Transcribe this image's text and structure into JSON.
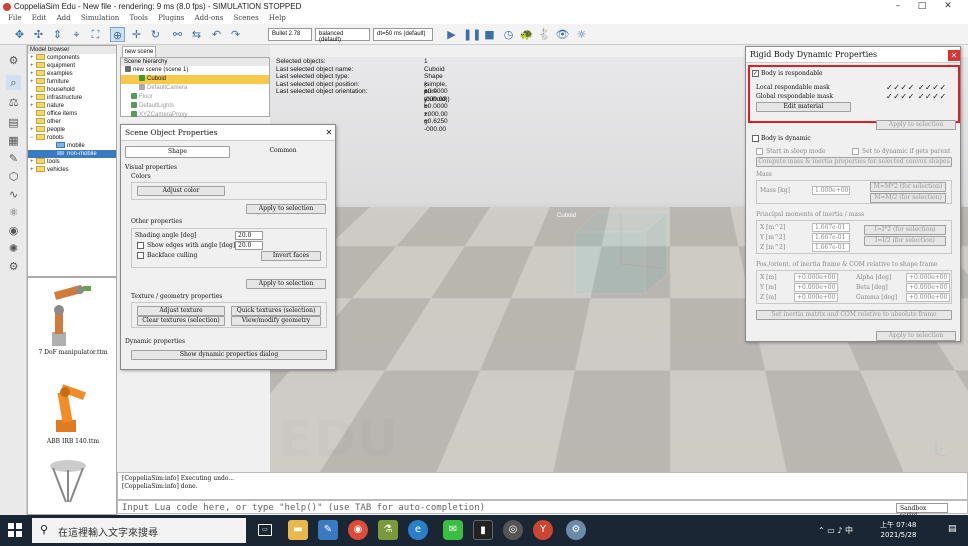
{
  "window": {
    "title": "CoppeliaSim Edu - New file - rendering: 9 ms (8.0 fps) - SIMULATION STOPPED"
  },
  "menu": [
    "File",
    "Edit",
    "Add",
    "Simulation",
    "Tools",
    "Plugins",
    "Add-ons",
    "Scenes",
    "Help"
  ],
  "toolbar": {
    "engine": "Bullet 2.78",
    "accuracy": "balanced (default)",
    "timestep": "dt=50 ms (default)"
  },
  "model_browser": {
    "header": "Model browser",
    "items": [
      {
        "label": "components",
        "expand": "+"
      },
      {
        "label": "equipment",
        "expand": "+"
      },
      {
        "label": "examples",
        "expand": "+"
      },
      {
        "label": "furniture",
        "expand": "+"
      },
      {
        "label": "household",
        "expand": ""
      },
      {
        "label": "infrastructure",
        "expand": "+"
      },
      {
        "label": "nature",
        "expand": "+"
      },
      {
        "label": "office items",
        "expand": ""
      },
      {
        "label": "other",
        "expand": ""
      },
      {
        "label": "people",
        "expand": "+"
      },
      {
        "label": "robots",
        "expand": "−"
      },
      {
        "label": "mobile",
        "expand": ""
      },
      {
        "label": "non-mobile",
        "expand": ""
      },
      {
        "label": "tools",
        "expand": "+"
      },
      {
        "label": "vehicles",
        "expand": "+"
      }
    ],
    "thumbnails": [
      "7 DoF manipulator.ttm",
      "ABB IRB 140.ttm"
    ]
  },
  "scene": {
    "tab": "new scene",
    "hierarchy_header": "Scene hierarchy",
    "items": [
      {
        "label": "new scene (scene 1)",
        "indent": 0
      },
      {
        "label": "Cuboid",
        "indent": 1
      },
      {
        "label": "DefaultCamera",
        "indent": 1
      },
      {
        "label": "Floor",
        "indent": 1
      },
      {
        "label": "DefaultLights",
        "indent": 1
      },
      {
        "label": "XYZCameraProxy",
        "indent": 1
      }
    ]
  },
  "viewport_info": {
    "rows": [
      {
        "label": "Selected objects:",
        "value": "1"
      },
      {
        "label": "Last selected object name:",
        "value": "Cuboid"
      },
      {
        "label": "Last selected object type:",
        "value": "Shape (simple, pure (cuboid))"
      },
      {
        "label": "Last selected object position:",
        "value": "x: +0.0000    y: +0.0000    z: +0.6250"
      },
      {
        "label": "Last selected object orientation:",
        "value": "a: -000.00    b: +000.00    g: -000.00"
      }
    ],
    "cube_label": "Cuboid",
    "watermark": "EDU"
  },
  "scene_object_props": {
    "title": "Scene Object Properties",
    "tabs": [
      "Shape",
      "Common"
    ],
    "visual_header": "Visual properties",
    "colors_label": "Colors",
    "adjust_color": "Adjust color",
    "apply_selection": "Apply to selection",
    "other_header": "Other properties",
    "shading_label": "Shading angle [deg]",
    "shading_value": "20.0",
    "edges_label": "Show edges with angle [deg]",
    "edges_value": "20.0",
    "backface_label": "Backface culling",
    "invert_faces": "Invert faces",
    "texture_header": "Texture / geometry properties",
    "adjust_texture": "Adjust texture",
    "quick_textures": "Quick textures (selection)",
    "clear_textures": "Clear textures (selection)",
    "view_geometry": "View/modify geometry",
    "dynamic_header": "Dynamic properties",
    "show_dynamic": "Show dynamic properties dialog"
  },
  "rigid_body": {
    "title": "Rigid Body Dynamic Properties",
    "respondable_label": "Body is respondable",
    "local_mask_label": "Local respondable mask",
    "global_mask_label": "Global respondable mask",
    "mask_checks": "✓✓✓✓  ✓✓✓✓",
    "edit_material": "Edit material",
    "apply_selection": "Apply to selection",
    "dynamic_label": "Body is dynamic",
    "sleep_label": "Start in sleep mode",
    "set_dynamic_label": "Set to dynamic if gets parent",
    "compute_mass": "Compute mass & inertia properties for selected convex shapes",
    "mass_header": "Mass",
    "mass_label": "Mass [kg]",
    "mass_value": "1.000e+00",
    "mass_x2": "M=M*2  (for selection)",
    "mass_half": "M=M/2  (for selection)",
    "inertia_header": "Principal moments of inertia / mass",
    "ix_label": "X [m^2]",
    "ix_value": "1.667e-01",
    "iy_label": "Y [m^2]",
    "iy_value": "1.667e-01",
    "iz_label": "Z [m^2]",
    "iz_value": "1.667e-01",
    "i_x2": "I=I*2  (for selection)",
    "i_half": "I=I/2  (for selection)",
    "pos_header": "Pos./orient. of inertia frame & COM relative to shape frame",
    "px_label": "X [m]",
    "px_value": "+0.000e+00",
    "py_label": "Y [m]",
    "py_value": "+0.000e+00",
    "pz_label": "Z [m]",
    "pz_value": "+0.000e+00",
    "alpha_label": "Alpha [deg]",
    "alpha_value": "+0.000e+00",
    "beta_label": "Beta [deg]",
    "beta_value": "+0.000e+00",
    "gamma_label": "Gamma [deg]",
    "gamma_value": "+0.000e+00",
    "set_inertia": "Set inertia matrix and COM relative to absolute frame",
    "apply_selection2": "Apply to selection"
  },
  "console": {
    "lines": [
      "[CoppeliaSim:info] Executing undo...",
      "[CoppeliaSim:info] done."
    ],
    "input_placeholder": "Input Lua code here, or type \"help()\" (use TAB for auto-completion)",
    "script_select": "Sandbox script"
  },
  "taskbar": {
    "search_placeholder": "在這裡輸入文字來搜尋",
    "time": "上午 07:48",
    "date": "2021/5/28"
  },
  "colors": {
    "highlight_box": "#e02020",
    "cube": "#3ecfcf",
    "selection": "#f7c94b"
  }
}
